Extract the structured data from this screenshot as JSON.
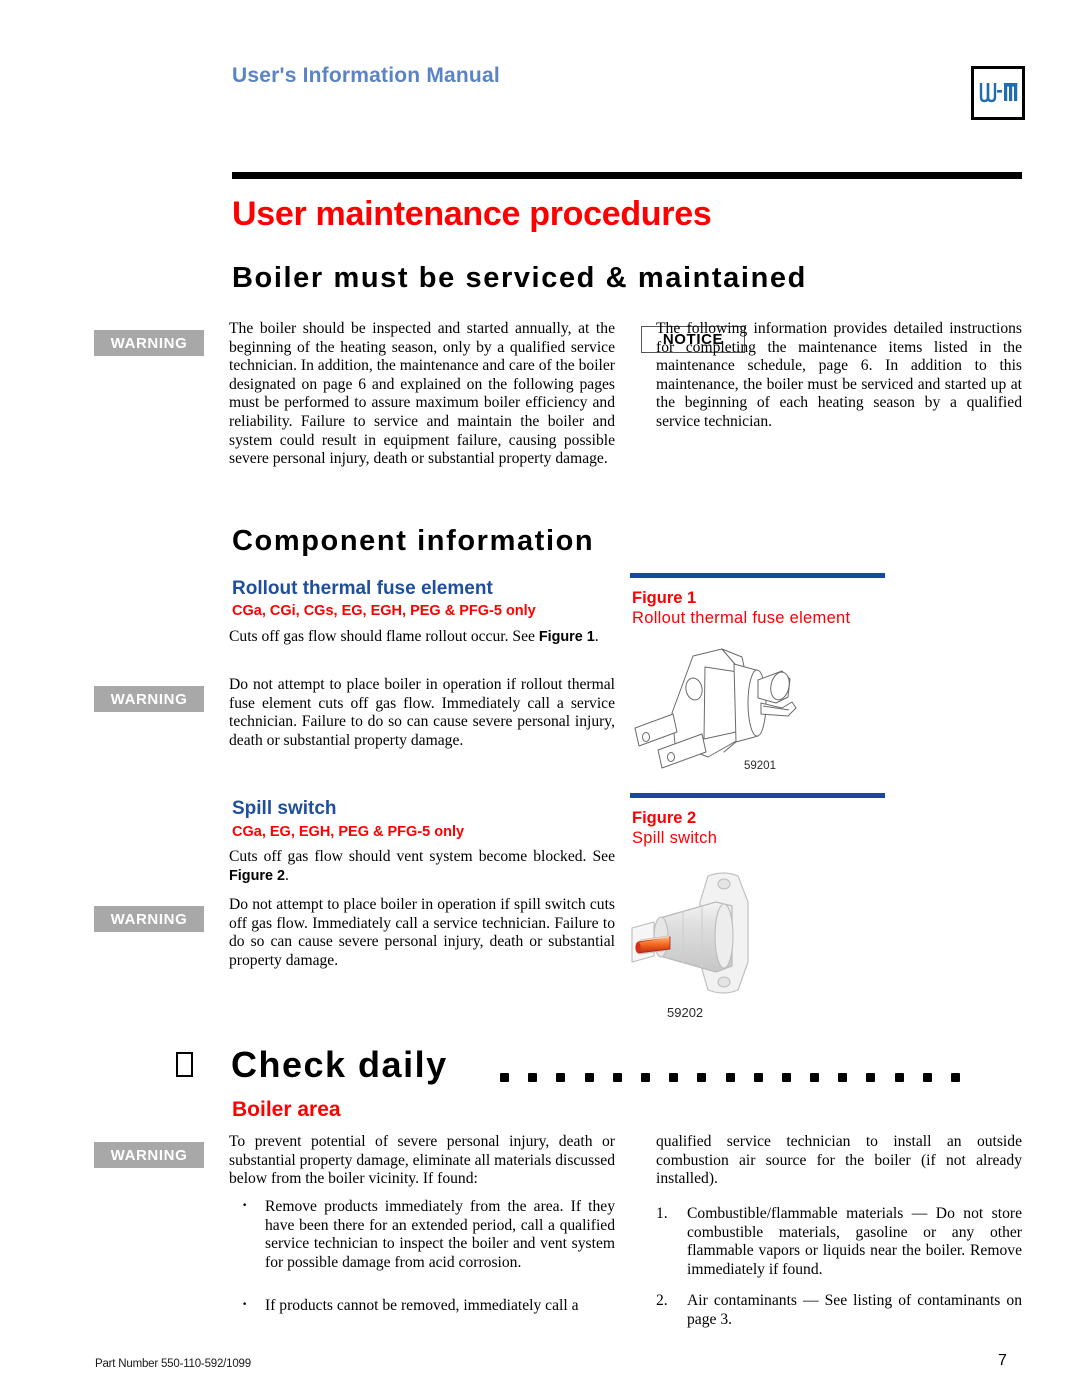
{
  "header": {
    "manual_title": "User's Information Manual",
    "logo_alt": "W-M"
  },
  "page_title": "User maintenance procedures",
  "sections": [
    {
      "heading": "Boiler must be serviced & maintained"
    },
    {
      "heading": "Component information"
    }
  ],
  "boiler_serviced": {
    "warning_label": "WARNING",
    "warning_text": "The boiler should be inspected and started annually, at the beginning of the heating season, only by a qualified service technician. In addition, the maintenance and care of the boiler designated on page 6 and explained on the following pages must be performed to assure maximum boiler efficiency and reliability. Failure to service and maintain the boiler and system could result in equipment failure, causing possible severe personal injury, death or substantial property damage.",
    "notice_label": "NOTICE",
    "notice_text": "The following information provides detailed instructions for completing the maintenance items listed in the maintenance schedule, page 6. In addition to this maintenance, the boiler must be serviced and started up at the beginning of each heating season by a qualified service technician."
  },
  "rollout": {
    "title": "Rollout thermal fuse element",
    "models": "CGa, CGi, CGs, EG, EGH, PEG & PFG-5 only",
    "desc_before": "Cuts off gas flow should flame rollout occur. See ",
    "desc_bold": "Figure 1",
    "desc_after": ".",
    "warning_label": "WARNING",
    "warning_text": "Do not attempt to place boiler in operation if rollout thermal fuse element cuts off gas flow. Immediately call a service technician. Failure to do so can cause severe personal injury, death or substantial property damage."
  },
  "figure1": {
    "number": "Figure 1",
    "description": "Rollout thermal fuse element",
    "part_number": "59201"
  },
  "spill": {
    "title": "Spill switch",
    "models": "CGa, EG, EGH, PEG & PFG-5 only",
    "desc_before": "Cuts off gas flow should vent system become blocked. See ",
    "desc_bold": "Figure 2",
    "desc_after": ".",
    "warning_label": "WARNING",
    "warning_text": "Do not attempt to place boiler in operation if spill switch cuts off gas flow. Immediately call a service technician. Failure to do so can cause severe personal injury, death or substantial property damage."
  },
  "figure2": {
    "number": "Figure 2",
    "description": "Spill switch",
    "part_number": "59202"
  },
  "check_daily": {
    "heading": "Check daily",
    "checkbox": "unchecked",
    "subheading": "Boiler area",
    "warning_label": "WARNING",
    "warning_text": "To prevent potential of severe personal injury, death or substantial property damage, eliminate all materials discussed below from the boiler vicinity. If found:",
    "bullets": [
      "Remove products immediately from the area. If they have been there for an extended period, call a qualified service technician to inspect the boiler and vent system for possible damage from acid corrosion.",
      "If products cannot be removed, immediately call a"
    ],
    "right_continuation": "qualified service technician to install an outside combustion air source for the boiler (if not already installed).",
    "numbered": [
      {
        "num": "1.",
        "text": "Combustible/flammable materials — Do not store combustible materials, gasoline or any other flammable vapors or liquids near the boiler. Remove immediately if found."
      },
      {
        "num": "2.",
        "text": "Air contaminants — See listing of contaminants on page 3."
      }
    ]
  },
  "footer": {
    "part_number": "Part Number 550-110-592/1099",
    "page_number": "7"
  },
  "colors": {
    "title_red": "#ff0000",
    "header_blue": "#5b84c4",
    "subhead_blue": "#1f4e9c",
    "figure_rule_blue": "#17479e",
    "warning_grey": "#a8a8a8"
  }
}
